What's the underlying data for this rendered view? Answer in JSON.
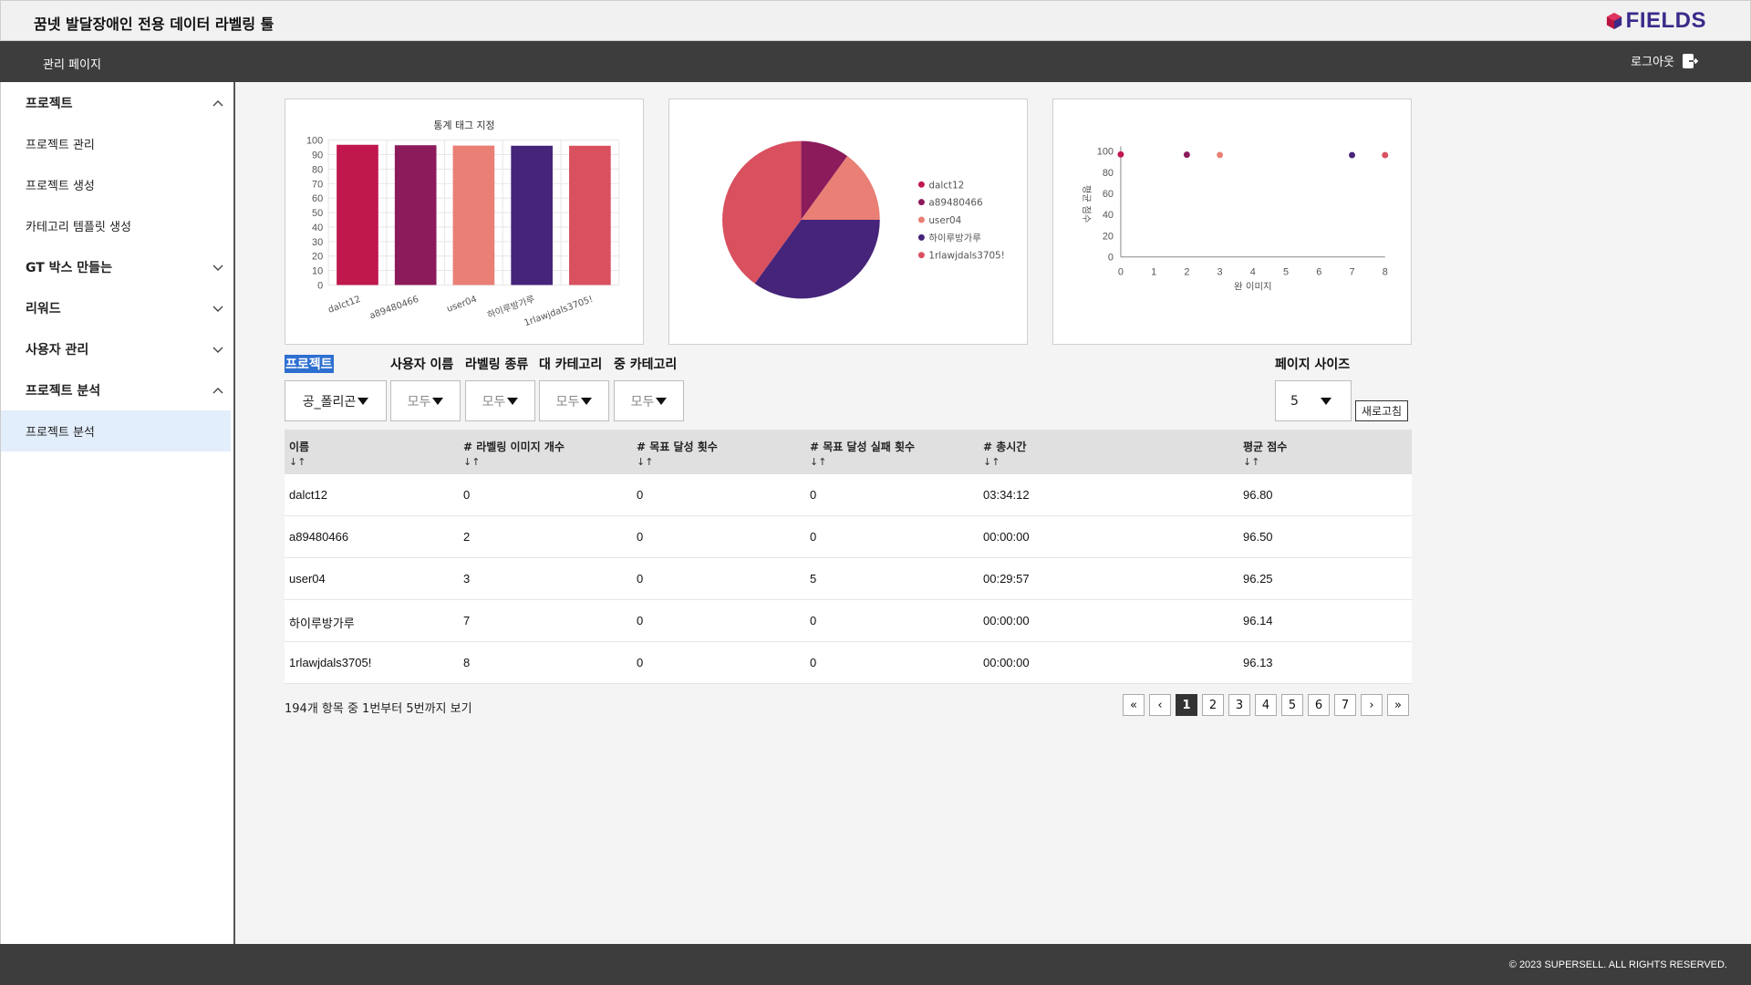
{
  "app": {
    "title": "꿈넷 발달장애인 전용 데이터 라벨링 툴",
    "logo_text": "FIELDS",
    "nav_title": "관리 페이지",
    "logout_label": "로그아웃",
    "footer_text": "© 2023 SUPERSELL. ALL RIGHTS RESERVED."
  },
  "sidebar": {
    "sections": [
      {
        "label": "프로젝트",
        "expanded": true,
        "items": [
          "프로젝트 관리",
          "프로젝트 생성",
          "카테고리 템플릿 생성"
        ]
      },
      {
        "label": "GT 박스 만들는",
        "expanded": false,
        "items": []
      },
      {
        "label": "리워드",
        "expanded": false,
        "items": []
      },
      {
        "label": "사용자 관리",
        "expanded": false,
        "items": []
      },
      {
        "label": "프로젝트 분석",
        "expanded": true,
        "items": [
          "프로젝트 분석"
        ]
      }
    ],
    "active_item": "프로젝트 분석"
  },
  "chart_data": [
    {
      "type": "bar",
      "title": "통계 태그 지정",
      "categories": [
        "dalct12",
        "a89480466",
        "user04",
        "하이루방가루",
        "1rlawjdals3705!"
      ],
      "values": [
        96.8,
        96.5,
        96.25,
        96.14,
        96.13
      ],
      "colors": [
        "#c0174d",
        "#8c1b5b",
        "#e97f75",
        "#45247a",
        "#d9505f"
      ],
      "ylim": [
        0,
        100
      ],
      "yticks": [
        0,
        10,
        20,
        30,
        40,
        50,
        60,
        70,
        80,
        90,
        100
      ],
      "grid": true
    },
    {
      "type": "pie",
      "labels": [
        "dalct12",
        "a89480466",
        "user04",
        "하이루방가루",
        "1rlawjdals3705!"
      ],
      "values": [
        0,
        2,
        3,
        7,
        8
      ],
      "colors": [
        "#c0174d",
        "#8c1b5b",
        "#e97f75",
        "#45247a",
        "#d9505f"
      ],
      "legend": "right"
    },
    {
      "type": "scatter",
      "xlabel": "완 이미지",
      "ylabel": "평균 점수",
      "points": [
        {
          "x": 0,
          "y": 96.8,
          "color": "#c0174d"
        },
        {
          "x": 2,
          "y": 96.5,
          "color": "#8c1b5b"
        },
        {
          "x": 3,
          "y": 96.25,
          "color": "#e97f75"
        },
        {
          "x": 7,
          "y": 96.14,
          "color": "#45247a"
        },
        {
          "x": 8,
          "y": 96.13,
          "color": "#d9505f"
        }
      ],
      "xlim": [
        0,
        8
      ],
      "ylim": [
        0,
        100
      ],
      "xticks": [
        0,
        1,
        2,
        3,
        4,
        5,
        6,
        7,
        8
      ],
      "yticks": [
        0,
        20,
        40,
        60,
        80,
        100
      ]
    }
  ],
  "filters": {
    "labels": {
      "project": "프로젝트",
      "user": "사용자 이름",
      "label_type": "라벨링 종류",
      "major_category": "대 카테고리",
      "mid_category": "중 카테고리",
      "page_size": "페이지 사이즈"
    },
    "project_value": "공_폴리곤",
    "user_value": "모두",
    "label_type_value": "모두",
    "major_value": "모두",
    "mid_value": "모두",
    "page_size_value": "5",
    "refresh_label": "새로고침"
  },
  "table": {
    "columns": [
      "이름",
      "# 라벨링 이미지 개수",
      "# 목표 달성 횟수",
      "# 목표 달성 실패 횟수",
      "# 총시간",
      "평균 점수"
    ],
    "sort_symbol": "↓↑",
    "rows": [
      [
        "dalct12",
        "0",
        "0",
        "0",
        "03:34:12",
        "96.80"
      ],
      [
        "a89480466",
        "2",
        "0",
        "0",
        "00:00:00",
        "96.50"
      ],
      [
        "user04",
        "3",
        "0",
        "5",
        "00:29:57",
        "96.25"
      ],
      [
        "하이루방가루",
        "7",
        "0",
        "0",
        "00:00:00",
        "96.14"
      ],
      [
        "1rlawjdals3705!",
        "8",
        "0",
        "0",
        "00:00:00",
        "96.13"
      ]
    ]
  },
  "pagination": {
    "summary": "194개 항목 중 1번부터 5번까지 보기",
    "first": "«",
    "prev": "‹",
    "next": "›",
    "last": "»",
    "pages": [
      "1",
      "2",
      "3",
      "4",
      "5",
      "6",
      "7"
    ],
    "current": "1"
  }
}
